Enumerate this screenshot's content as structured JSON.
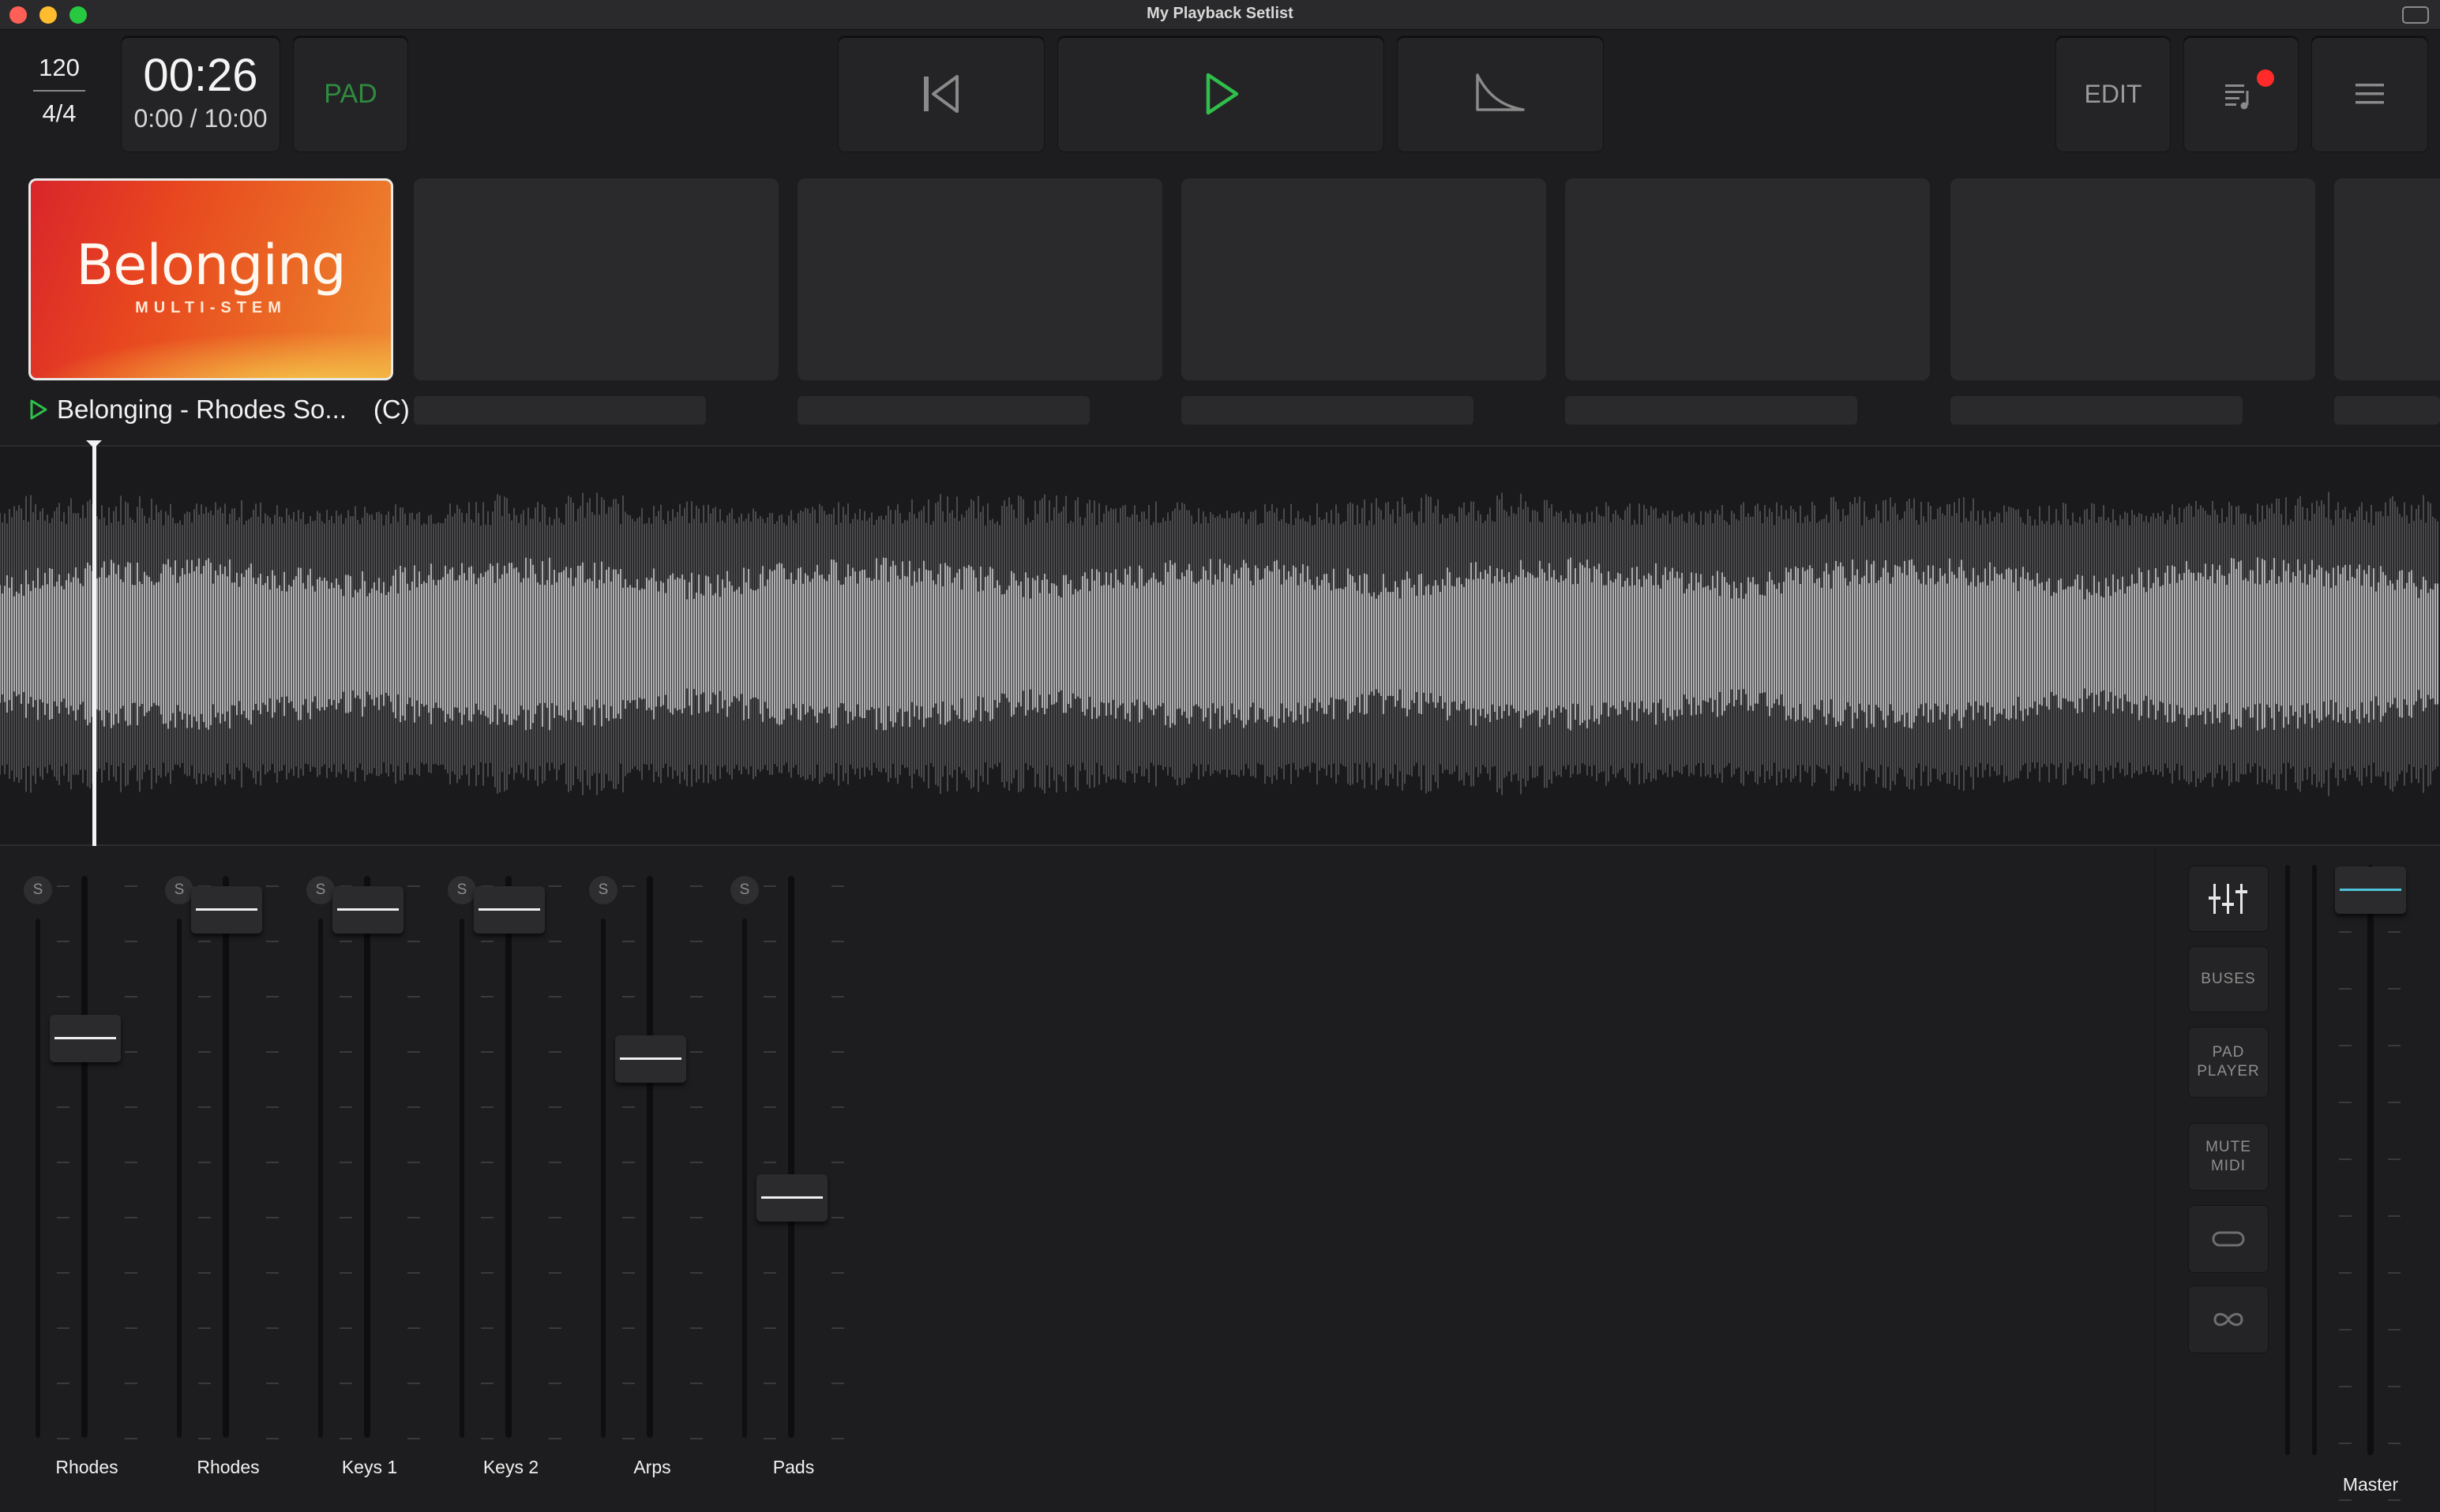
{
  "window": {
    "title": "My Playback Setlist"
  },
  "transport": {
    "bpm": "120",
    "time_signature": "4/4",
    "elapsed": "00:26",
    "position_range": "0:00 / 10:00",
    "pad_label": "PAD",
    "edit_label": "EDIT"
  },
  "setlist": {
    "active_song": {
      "art_title": "Belonging",
      "art_subtitle": "MULTI-STEM",
      "label": "Belonging - Rhodes So...",
      "key": "(C)"
    }
  },
  "mixer": {
    "solo_label": "S",
    "channels": [
      {
        "name": "Rhodes",
        "level": 0.73
      },
      {
        "name": "Rhodes",
        "level": 0.98
      },
      {
        "name": "Keys 1",
        "level": 0.98
      },
      {
        "name": "Keys 2",
        "level": 0.98
      },
      {
        "name": "Arps",
        "level": 0.69
      },
      {
        "name": "Pads",
        "level": 0.42
      }
    ],
    "side_buttons": {
      "buses": "BUSES",
      "pad_player_line1": "PAD",
      "pad_player_line2": "PLAYER",
      "mute_midi_line1": "MUTE",
      "mute_midi_line2": "MIDI"
    },
    "master": {
      "name": "Master",
      "level": 1.0
    }
  },
  "colors": {
    "accent_green": "#2fbf4a",
    "pad_green": "#2e8c3f",
    "notification_red": "#ff2a2a",
    "master_accent": "#4fc3d9"
  }
}
